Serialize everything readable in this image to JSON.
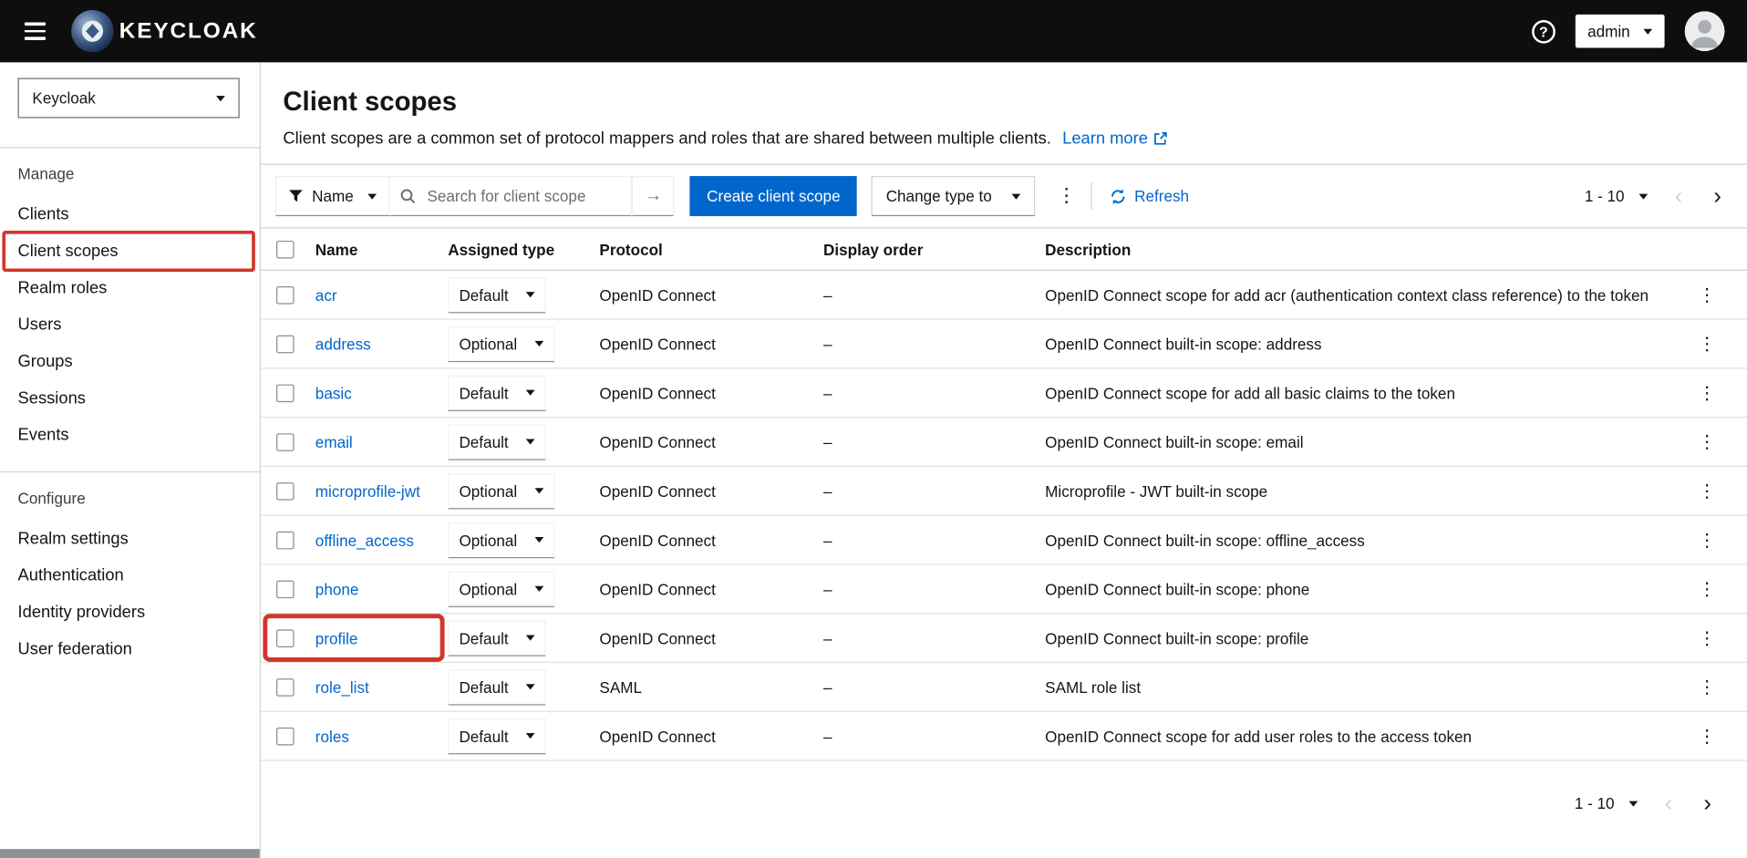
{
  "header": {
    "brand": "KEYCLOAK",
    "user_menu": {
      "label": "admin"
    }
  },
  "sidebar": {
    "realm_selector": {
      "value": "Keycloak"
    },
    "sections": [
      {
        "title": "Manage",
        "items": [
          {
            "label": "Clients"
          },
          {
            "label": "Client scopes",
            "selected": true
          },
          {
            "label": "Realm roles"
          },
          {
            "label": "Users"
          },
          {
            "label": "Groups"
          },
          {
            "label": "Sessions"
          },
          {
            "label": "Events"
          }
        ]
      },
      {
        "title": "Configure",
        "items": [
          {
            "label": "Realm settings"
          },
          {
            "label": "Authentication"
          },
          {
            "label": "Identity providers"
          },
          {
            "label": "User federation"
          }
        ]
      }
    ]
  },
  "main": {
    "title": "Client scopes",
    "description": "Client scopes are a common set of protocol mappers and roles that are shared between multiple clients.",
    "learn_more_label": "Learn more",
    "toolbar": {
      "filter_label": "Name",
      "search_placeholder": "Search for client scope",
      "create_button_label": "Create client scope",
      "change_type_label": "Change type to",
      "refresh_label": "Refresh",
      "pagination_range": "1 - 10"
    },
    "table": {
      "columns": [
        "Name",
        "Assigned type",
        "Protocol",
        "Display order",
        "Description"
      ],
      "rows": [
        {
          "name": "acr",
          "assigned_type": "Default",
          "protocol": "OpenID Connect",
          "display_order": "–",
          "description": "OpenID Connect scope for add acr (authentication context class reference) to the token"
        },
        {
          "name": "address",
          "assigned_type": "Optional",
          "protocol": "OpenID Connect",
          "display_order": "–",
          "description": "OpenID Connect built-in scope: address"
        },
        {
          "name": "basic",
          "assigned_type": "Default",
          "protocol": "OpenID Connect",
          "display_order": "–",
          "description": "OpenID Connect scope for add all basic claims to the token"
        },
        {
          "name": "email",
          "assigned_type": "Default",
          "protocol": "OpenID Connect",
          "display_order": "–",
          "description": "OpenID Connect built-in scope: email"
        },
        {
          "name": "microprofile-jwt",
          "assigned_type": "Optional",
          "protocol": "OpenID Connect",
          "display_order": "–",
          "description": "Microprofile - JWT built-in scope"
        },
        {
          "name": "offline_access",
          "assigned_type": "Optional",
          "protocol": "OpenID Connect",
          "display_order": "–",
          "description": "OpenID Connect built-in scope: offline_access"
        },
        {
          "name": "phone",
          "assigned_type": "Optional",
          "protocol": "OpenID Connect",
          "display_order": "–",
          "description": "OpenID Connect built-in scope: phone"
        },
        {
          "name": "profile",
          "assigned_type": "Default",
          "protocol": "OpenID Connect",
          "display_order": "–",
          "description": "OpenID Connect built-in scope: profile",
          "annotated": true
        },
        {
          "name": "role_list",
          "assigned_type": "Default",
          "protocol": "SAML",
          "display_order": "–",
          "description": "SAML role list"
        },
        {
          "name": "roles",
          "assigned_type": "Default",
          "protocol": "OpenID Connect",
          "display_order": "–",
          "description": "OpenID Connect scope for add user roles to the access token"
        }
      ]
    },
    "bottom_pagination_range": "1 - 10"
  },
  "icons": {
    "help": "?",
    "kebab": "⋮",
    "search_submit_arrow": "→",
    "prev_chevron": "‹",
    "next_chevron": "›"
  },
  "colors": {
    "accent_blue": "#0066cc",
    "annotation_red": "#d2352a",
    "masthead_black": "#0e0e0e"
  }
}
